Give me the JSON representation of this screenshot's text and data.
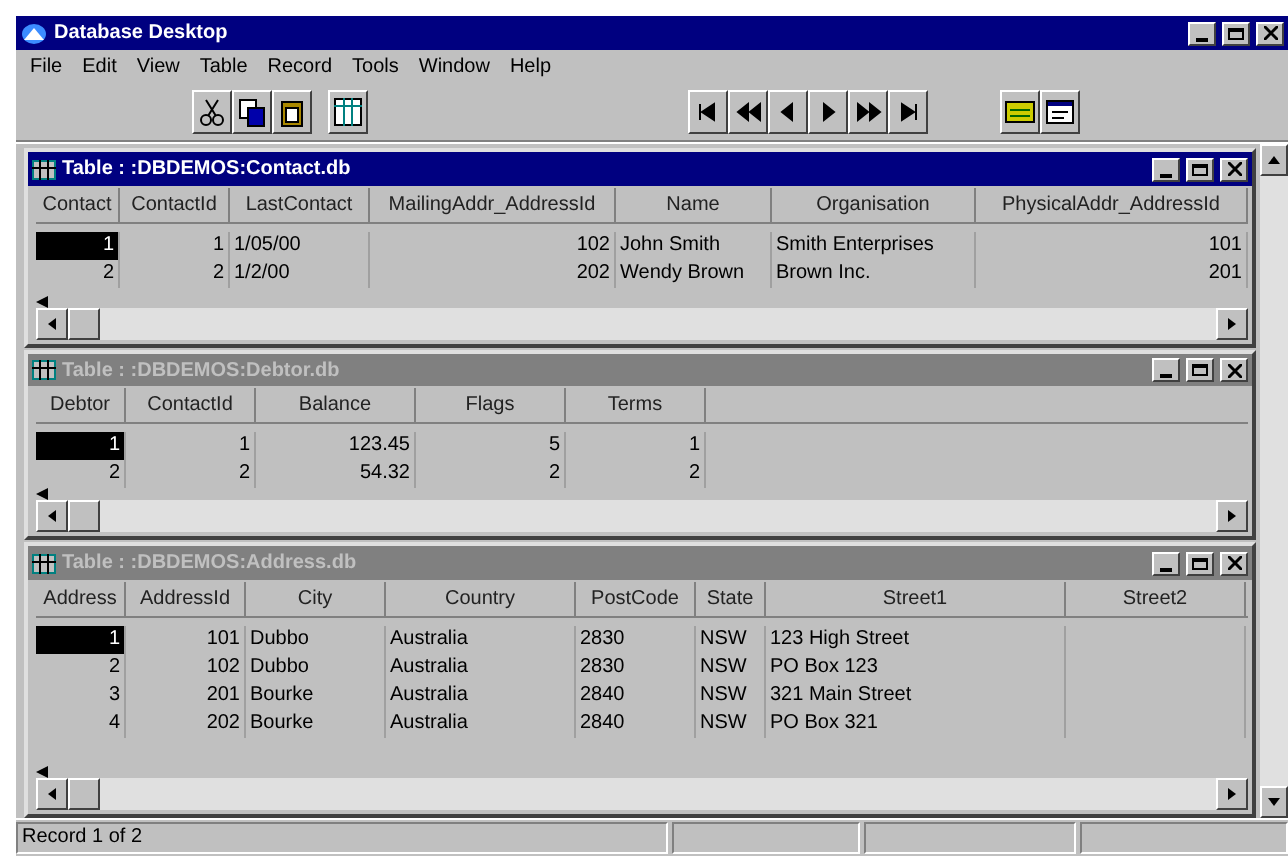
{
  "window": {
    "title": "Database Desktop"
  },
  "menu": [
    "File",
    "Edit",
    "View",
    "Table",
    "Record",
    "Tools",
    "Window",
    "Help"
  ],
  "tables": [
    {
      "title": "Table : :DBDEMOS:Contact.db",
      "active": true,
      "columns": [
        {
          "label": "Contact",
          "kind": "number"
        },
        {
          "label": "ContactId",
          "kind": "number"
        },
        {
          "label": "LastContact",
          "kind": "text"
        },
        {
          "label": "MailingAddr_AddressId",
          "kind": "number"
        },
        {
          "label": "Name",
          "kind": "text"
        },
        {
          "label": "Organisation",
          "kind": "text"
        },
        {
          "label": "PhysicalAddr_AddressId",
          "kind": "number"
        }
      ],
      "rows": [
        {
          "selected": true,
          "cells": [
            "1",
            "1",
            "1/05/00",
            "102",
            "John Smith",
            "Smith Enterprises",
            "101"
          ]
        },
        {
          "selected": false,
          "cells": [
            "2",
            "2",
            "1/2/00",
            "202",
            "Wendy Brown",
            "Brown Inc.",
            "201"
          ]
        }
      ]
    },
    {
      "title": "Table : :DBDEMOS:Debtor.db",
      "active": false,
      "columns": [
        {
          "label": "Debtor",
          "kind": "number"
        },
        {
          "label": "ContactId",
          "kind": "number"
        },
        {
          "label": "Balance",
          "kind": "number"
        },
        {
          "label": "Flags",
          "kind": "number"
        },
        {
          "label": "Terms",
          "kind": "number"
        }
      ],
      "rows": [
        {
          "selected": true,
          "cells": [
            "1",
            "1",
            "123.45",
            "5",
            "1"
          ]
        },
        {
          "selected": false,
          "cells": [
            "2",
            "2",
            "54.32",
            "2",
            "2"
          ]
        }
      ]
    },
    {
      "title": "Table : :DBDEMOS:Address.db",
      "active": false,
      "columns": [
        {
          "label": "Address",
          "kind": "number"
        },
        {
          "label": "AddressId",
          "kind": "number"
        },
        {
          "label": "City",
          "kind": "text"
        },
        {
          "label": "Country",
          "kind": "text"
        },
        {
          "label": "PostCode",
          "kind": "text"
        },
        {
          "label": "State",
          "kind": "text"
        },
        {
          "label": "Street1",
          "kind": "text"
        },
        {
          "label": "Street2",
          "kind": "text"
        }
      ],
      "rows": [
        {
          "selected": true,
          "cells": [
            "1",
            "101",
            "Dubbo",
            "Australia",
            "2830",
            "NSW",
            "123 High Street",
            ""
          ]
        },
        {
          "selected": false,
          "cells": [
            "2",
            "102",
            "Dubbo",
            "Australia",
            "2830",
            "NSW",
            "PO Box 123",
            ""
          ]
        },
        {
          "selected": false,
          "cells": [
            "3",
            "201",
            "Bourke",
            "Australia",
            "2840",
            "NSW",
            "321 Main Street",
            ""
          ]
        },
        {
          "selected": false,
          "cells": [
            "4",
            "202",
            "Bourke",
            "Australia",
            "2840",
            "NSW",
            "PO Box 321",
            ""
          ]
        }
      ]
    }
  ],
  "status_bar": {
    "text": "Record 1 of 2"
  }
}
